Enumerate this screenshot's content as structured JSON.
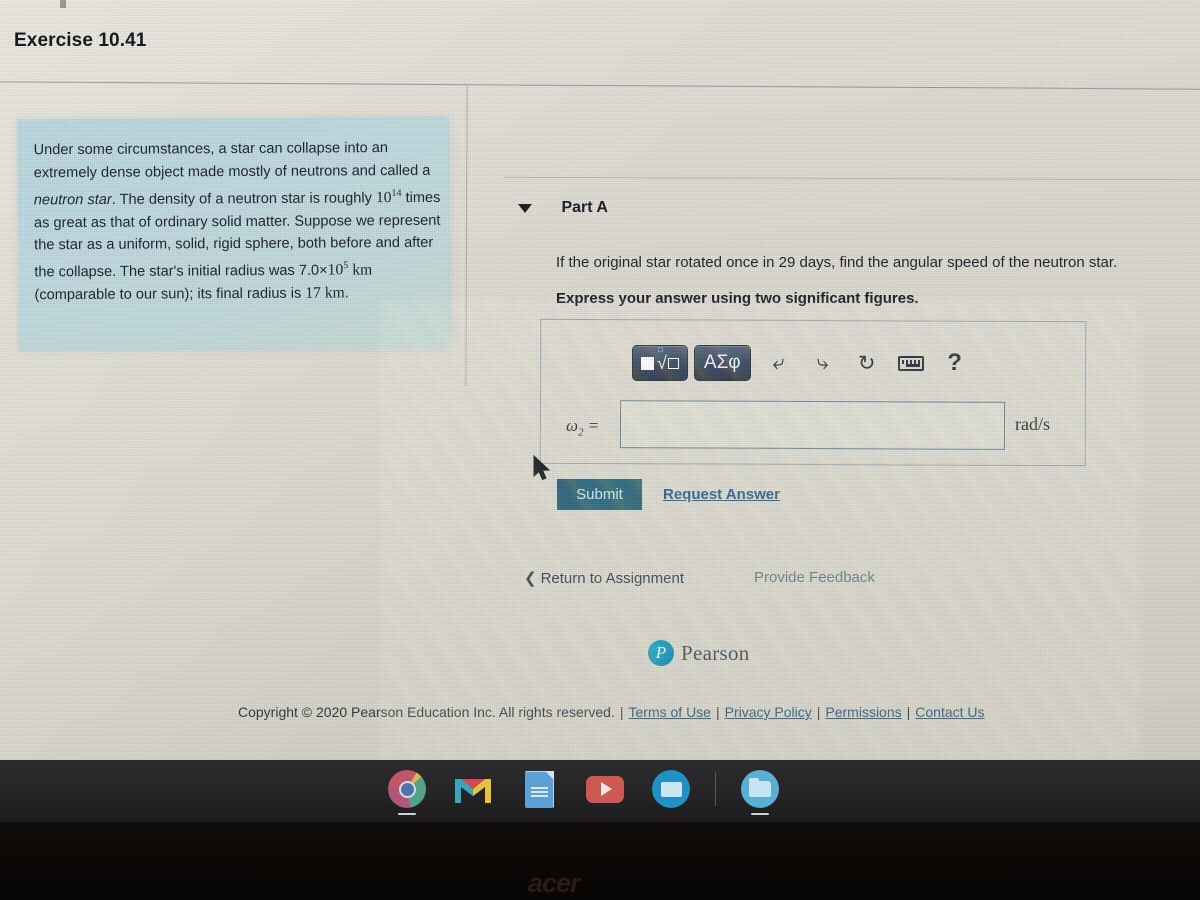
{
  "exercise": {
    "title": "Exercise 10.41"
  },
  "problem": {
    "text_html": "Under some circumstances, a star can collapse into an extremely dense object made mostly of neutrons and called a <i class=\"ital\">neutron star</i>. The density of a neutron star is roughly <span class=\"serif\">10<sup>14</sup></span> times as great as that of ordinary solid matter. Suppose we represent the star as a uniform, solid, rigid sphere, both before and after the collapse. The star's initial radius was 7.0&#215;<span class=\"serif\">10<sup>5</sup></span> <span class=\"serif\">km</span> (comparable to our sun); its final radius is <span class=\"serif\">17 km</span>.",
    "plain_text": "Under some circumstances, a star can collapse into an extremely dense object made mostly of neutrons and called a neutron star. The density of a neutron star is roughly 10^14 times as great as that of ordinary solid matter. Suppose we represent the star as a uniform, solid, rigid sphere, both before and after the collapse. The star's initial radius was 7.0×10^5 km (comparable to our sun); its final radius is 17 km.",
    "initial_radius": "7.0×10^5 km",
    "final_radius": "17 km",
    "density_factor": "10^14"
  },
  "part": {
    "label": "Part A",
    "question": "If the original star rotated once in 29 days, find the angular speed of the neutron star.",
    "instruction": "Express your answer using two significant figures.",
    "rotation_period": "29 days",
    "sig_figs": "two"
  },
  "answer": {
    "variable_symbol": "ω",
    "variable_subscript": "2",
    "equals": "=",
    "value": "",
    "placeholder": "",
    "unit": "rad/s"
  },
  "toolbar": {
    "template_button": "math-template",
    "greek_button": "ΑΣφ",
    "undo": "undo-arrow",
    "redo": "redo-arrow",
    "reset": "reset-circular-arrow",
    "keyboard": "keyboard-icon",
    "help": "?"
  },
  "actions": {
    "submit": "Submit",
    "request_answer": "Request Answer",
    "return_to_assignment": "Return to Assignment",
    "return_chevron": "❮",
    "provide_feedback": "Provide Feedback"
  },
  "footer": {
    "brand_mark": "P",
    "brand_name": "Pearson",
    "copyright": "Copyright © 2020 Pearson Education Inc. All rights reserved.",
    "separator": "|",
    "links": [
      "Terms of Use",
      "Privacy Policy",
      "Permissions",
      "Contact Us"
    ]
  },
  "shelf": {
    "apps": [
      {
        "name": "Chrome",
        "icon": "chrome-icon"
      },
      {
        "name": "Gmail",
        "icon": "gmail-icon"
      },
      {
        "name": "Google Docs",
        "icon": "docs-icon"
      },
      {
        "name": "YouTube",
        "icon": "youtube-icon"
      },
      {
        "name": "Google Classroom",
        "icon": "classroom-icon"
      },
      {
        "name": "Files",
        "icon": "files-icon"
      }
    ]
  },
  "device": {
    "brand": "acer"
  },
  "colors": {
    "link": "#22587e",
    "submit_bg": "#23536d",
    "problem_panel": "#bcd9e2",
    "toolbar_button": "#2e3a50",
    "pearson_blue": "#0e86ae"
  }
}
